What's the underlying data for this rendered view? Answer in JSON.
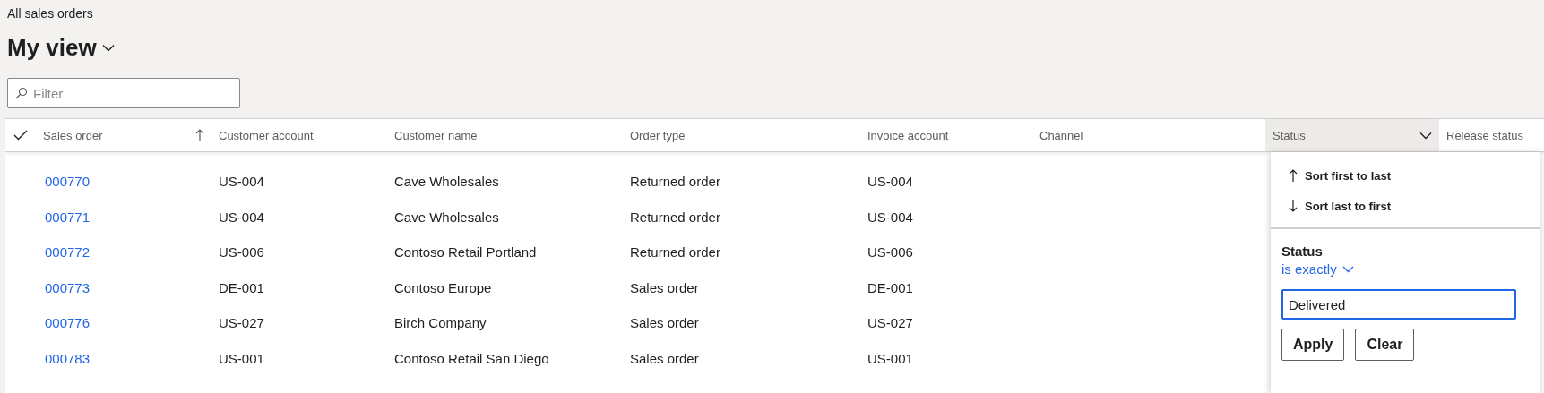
{
  "page_title": "All sales orders",
  "view": {
    "title": "My view"
  },
  "filter": {
    "placeholder": "Filter"
  },
  "table": {
    "columns": [
      {
        "label": "Sales order",
        "sorted": true,
        "menu_open": false
      },
      {
        "label": "Customer account",
        "sorted": false,
        "menu_open": false
      },
      {
        "label": "Customer name",
        "sorted": false,
        "menu_open": false
      },
      {
        "label": "Order type",
        "sorted": false,
        "menu_open": false
      },
      {
        "label": "Invoice account",
        "sorted": false,
        "menu_open": false
      },
      {
        "label": "Channel",
        "sorted": false,
        "menu_open": false
      },
      {
        "label": "Status",
        "sorted": false,
        "menu_open": true
      },
      {
        "label": "Release status",
        "sorted": false,
        "menu_open": false
      }
    ],
    "rows": [
      {
        "sales_order": "000770",
        "customer_account": "US-004",
        "customer_name": "Cave Wholesales",
        "order_type": "Returned order",
        "invoice_account": "US-004"
      },
      {
        "sales_order": "000771",
        "customer_account": "US-004",
        "customer_name": "Cave Wholesales",
        "order_type": "Returned order",
        "invoice_account": "US-004"
      },
      {
        "sales_order": "000772",
        "customer_account": "US-006",
        "customer_name": "Contoso Retail Portland",
        "order_type": "Returned order",
        "invoice_account": "US-006"
      },
      {
        "sales_order": "000773",
        "customer_account": "DE-001",
        "customer_name": "Contoso Europe",
        "order_type": "Sales order",
        "invoice_account": "DE-001"
      },
      {
        "sales_order": "000776",
        "customer_account": "US-027",
        "customer_name": "Birch Company",
        "order_type": "Sales order",
        "invoice_account": "US-027"
      },
      {
        "sales_order": "000783",
        "customer_account": "US-001",
        "customer_name": "Contoso Retail San Diego",
        "order_type": "Sales order",
        "invoice_account": "US-001"
      }
    ]
  },
  "column_menu": {
    "sort_items": [
      {
        "label": "Sort first to last",
        "kind": "ascending"
      },
      {
        "label": "Sort last to first",
        "kind": "descending"
      }
    ],
    "field_label": "Status",
    "operator": "is exactly",
    "value": "Delivered",
    "buttons": [
      "Apply",
      "Clear"
    ]
  }
}
